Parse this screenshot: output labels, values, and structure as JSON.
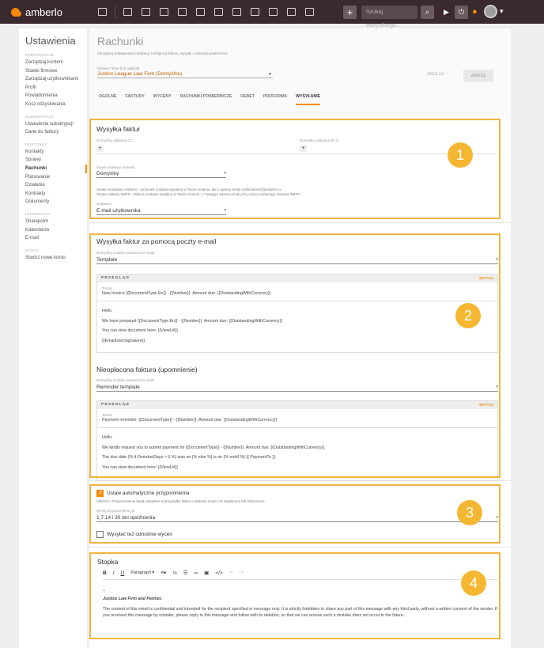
{
  "topbar": {
    "brand": "amberlo",
    "search_placeholder": "Szukaj wszystkiego..."
  },
  "sidebar": {
    "title": "Ustawienia",
    "sections": [
      {
        "heading": "PREFERENCJE",
        "items": [
          "Zarządzaj kontem",
          "Stawki firmowe",
          "Zarządzaj użytkownikami",
          "Profil",
          "Powiadomienia",
          "Kosz odzyskiwania"
        ]
      },
      {
        "heading": "SUBSKRYPCJA",
        "items": [
          "Ustawienia subskrypcji",
          "Dane do faktury"
        ]
      },
      {
        "heading": "DOSTOSUJ",
        "items": [
          "Kontakty",
          "Sprawy",
          "Rachunki",
          "Planowanie",
          "Działania",
          "Kontrakty",
          "Dokumenty"
        ]
      },
      {
        "heading": "INTEGRACJA",
        "items": [
          "Sharepoint",
          "Kalendarze",
          "E-mail"
        ]
      },
      {
        "heading": "KONTA",
        "items": [
          "Stwórz nowe konto"
        ]
      }
    ],
    "active_item": "Rachunki"
  },
  "header": {
    "title": "Rachunki",
    "subtitle": "Zarządzaj ustawieniami realizacji, konfiguruj faktury, wysyłaj i rachunki powiernicze",
    "firm_label": "Wybierz firmę (lub oddział)",
    "firm_value": "Justice League Law Firm (Domyślne)",
    "cancel_label": "ANULUJ",
    "save_label": "ZAPISZ",
    "tabs": [
      "OGÓLNE",
      "FAKTURY",
      "WYCENY",
      "RACHUNKI POWIERNICZE",
      "DEBET",
      "PROFORMA",
      "WYSYŁANIE"
    ],
    "active_tab": "WYSYŁANIE"
  },
  "sending": {
    "title": "Wysyłka faktur",
    "cc_label": "Domyślny odbiorca CC",
    "bcc_label": "Domyślny odbiorca BCC",
    "mail_service_label": "Serwis mailowy Amberlo",
    "mail_service_value": "Domyślny",
    "note1": "Serwis emailowy Amberlo - rachunek zostanie wysłany w Twoim imieniu, ale z adresu email notifications@amberlo.io.",
    "note2": "Serwer własny SMTP - faktura zostanie wysłana w Twoim imieniu i z Twojego adresu email przy użyciu podanego serwera SMTP.",
    "sender_label": "Nadawca",
    "sender_value": "E-mail użytkownika"
  },
  "email_section": {
    "title": "Wysyłka faktur za pomocą poczty e-mail",
    "template_label": "Domyślny szablon wiadomości email",
    "template_value": "Template",
    "preview_label": "PRZEGLĄD",
    "edit_label": "EDYTUJ",
    "subject_label": "Temat",
    "subject": "New Invoice {{DocumentType.En}} - {{Number}}. Amount due: {{OutstandingWithCurrency}}",
    "body": [
      "Hello,",
      "We have prepared {{DocumentType.En}} - {{Number}}. Amount due: {{OutstandingWithCurrency}}.",
      "You can view document here: {{ViewUrl}}",
      "{{EmailUserSignature}}"
    ],
    "unpaid_title": "Nieopłacona faktura (upomnienie)",
    "reminder_template_label": "Domyślny szablon wiadomości email",
    "reminder_template_value": "Reminder template",
    "reminder_subject": "Payment reminder: {{DocumentType}} - {{Number}}. Amount due: {{OutstandingWithCurrency}}",
    "reminder_body": [
      "Hello,",
      "We kindly request you to submit payment for {{DocumentType}} - {{Number}}. Amount due: {{OutstandingWithCurrency}}.",
      "The due date {% if OverdueDays > 0 %} was on {% else %} is on {% endif %} {{ PaymentTo }}.",
      "You can view document here: {{ViewUrl}}"
    ]
  },
  "reminders": {
    "auto_label": "Ustaw automatyczne przypomnienia",
    "auto_checked": true,
    "note": "UWAGA: Przypomnienia będą wysyłane w przypadku faktur o statusie innym niż Zapłacone lub Odrzucone",
    "send_after_label": "Wyślij przypomnienie po",
    "send_after_value": "1,7,14 i 30 dni opóźnienia",
    "quotes_label": "Wysyłać też odnośnie wycen",
    "quotes_checked": false
  },
  "footer_section": {
    "title": "Stopka",
    "paragraph_label": "Paragraph",
    "dash": "–",
    "signature": "Justice Law Firm and Partner.",
    "disclaimer": "The content of this email is confidential and intended for the recipient specified in message only. It is strictly forbidden to share any part of this message with any third party, without a written consent of the sender. If you received this message by mistake, please reply to this message and follow with its deletion, so that we can ensure such a mistake does not occur in the future."
  },
  "badges": [
    "1",
    "2",
    "3",
    "4"
  ],
  "colors": {
    "accent": "#f58a07",
    "highlight": "#f2b441",
    "topbar": "#3a2a2e"
  }
}
